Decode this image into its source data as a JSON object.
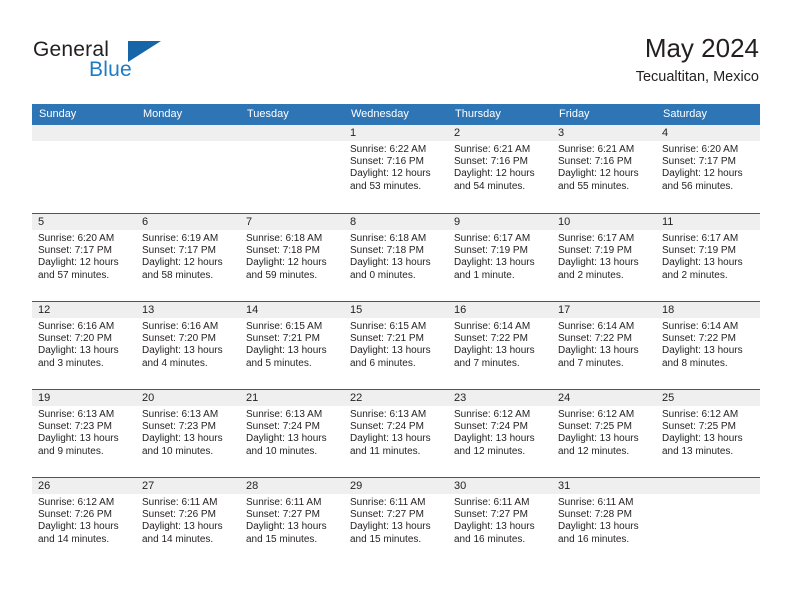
{
  "brand": {
    "name_part1": "General",
    "name_part2": "Blue",
    "triangle_icon": "blue-triangle-logo-mark",
    "accent_color": "#1d7cc4",
    "triangle_color": "#1565a8"
  },
  "header": {
    "title": "May 2024",
    "subtitle": "Tecualtitan, Mexico"
  },
  "theme": {
    "header_row_color": "#2e75b6",
    "row_divider_color": "#1f5fa0",
    "day_strip_color": "#efefef",
    "text_color": "#231f20"
  },
  "weekdays": [
    "Sunday",
    "Monday",
    "Tuesday",
    "Wednesday",
    "Thursday",
    "Friday",
    "Saturday"
  ],
  "weeks": [
    [
      {
        "day": "",
        "empty": true,
        "sunrise": "",
        "sunset": "",
        "daylight_line1": "",
        "daylight_line2": ""
      },
      {
        "day": "",
        "empty": true,
        "sunrise": "",
        "sunset": "",
        "daylight_line1": "",
        "daylight_line2": ""
      },
      {
        "day": "",
        "empty": true,
        "sunrise": "",
        "sunset": "",
        "daylight_line1": "",
        "daylight_line2": ""
      },
      {
        "day": "1",
        "sunrise": "Sunrise: 6:22 AM",
        "sunset": "Sunset: 7:16 PM",
        "daylight_line1": "Daylight: 12 hours",
        "daylight_line2": "and 53 minutes."
      },
      {
        "day": "2",
        "sunrise": "Sunrise: 6:21 AM",
        "sunset": "Sunset: 7:16 PM",
        "daylight_line1": "Daylight: 12 hours",
        "daylight_line2": "and 54 minutes."
      },
      {
        "day": "3",
        "sunrise": "Sunrise: 6:21 AM",
        "sunset": "Sunset: 7:16 PM",
        "daylight_line1": "Daylight: 12 hours",
        "daylight_line2": "and 55 minutes."
      },
      {
        "day": "4",
        "sunrise": "Sunrise: 6:20 AM",
        "sunset": "Sunset: 7:17 PM",
        "daylight_line1": "Daylight: 12 hours",
        "daylight_line2": "and 56 minutes."
      }
    ],
    [
      {
        "day": "5",
        "sunrise": "Sunrise: 6:20 AM",
        "sunset": "Sunset: 7:17 PM",
        "daylight_line1": "Daylight: 12 hours",
        "daylight_line2": "and 57 minutes."
      },
      {
        "day": "6",
        "sunrise": "Sunrise: 6:19 AM",
        "sunset": "Sunset: 7:17 PM",
        "daylight_line1": "Daylight: 12 hours",
        "daylight_line2": "and 58 minutes."
      },
      {
        "day": "7",
        "sunrise": "Sunrise: 6:18 AM",
        "sunset": "Sunset: 7:18 PM",
        "daylight_line1": "Daylight: 12 hours",
        "daylight_line2": "and 59 minutes."
      },
      {
        "day": "8",
        "sunrise": "Sunrise: 6:18 AM",
        "sunset": "Sunset: 7:18 PM",
        "daylight_line1": "Daylight: 13 hours",
        "daylight_line2": "and 0 minutes."
      },
      {
        "day": "9",
        "sunrise": "Sunrise: 6:17 AM",
        "sunset": "Sunset: 7:19 PM",
        "daylight_line1": "Daylight: 13 hours",
        "daylight_line2": "and 1 minute."
      },
      {
        "day": "10",
        "sunrise": "Sunrise: 6:17 AM",
        "sunset": "Sunset: 7:19 PM",
        "daylight_line1": "Daylight: 13 hours",
        "daylight_line2": "and 2 minutes."
      },
      {
        "day": "11",
        "sunrise": "Sunrise: 6:17 AM",
        "sunset": "Sunset: 7:19 PM",
        "daylight_line1": "Daylight: 13 hours",
        "daylight_line2": "and 2 minutes."
      }
    ],
    [
      {
        "day": "12",
        "sunrise": "Sunrise: 6:16 AM",
        "sunset": "Sunset: 7:20 PM",
        "daylight_line1": "Daylight: 13 hours",
        "daylight_line2": "and 3 minutes."
      },
      {
        "day": "13",
        "sunrise": "Sunrise: 6:16 AM",
        "sunset": "Sunset: 7:20 PM",
        "daylight_line1": "Daylight: 13 hours",
        "daylight_line2": "and 4 minutes."
      },
      {
        "day": "14",
        "sunrise": "Sunrise: 6:15 AM",
        "sunset": "Sunset: 7:21 PM",
        "daylight_line1": "Daylight: 13 hours",
        "daylight_line2": "and 5 minutes."
      },
      {
        "day": "15",
        "sunrise": "Sunrise: 6:15 AM",
        "sunset": "Sunset: 7:21 PM",
        "daylight_line1": "Daylight: 13 hours",
        "daylight_line2": "and 6 minutes."
      },
      {
        "day": "16",
        "sunrise": "Sunrise: 6:14 AM",
        "sunset": "Sunset: 7:22 PM",
        "daylight_line1": "Daylight: 13 hours",
        "daylight_line2": "and 7 minutes."
      },
      {
        "day": "17",
        "sunrise": "Sunrise: 6:14 AM",
        "sunset": "Sunset: 7:22 PM",
        "daylight_line1": "Daylight: 13 hours",
        "daylight_line2": "and 7 minutes."
      },
      {
        "day": "18",
        "sunrise": "Sunrise: 6:14 AM",
        "sunset": "Sunset: 7:22 PM",
        "daylight_line1": "Daylight: 13 hours",
        "daylight_line2": "and 8 minutes."
      }
    ],
    [
      {
        "day": "19",
        "sunrise": "Sunrise: 6:13 AM",
        "sunset": "Sunset: 7:23 PM",
        "daylight_line1": "Daylight: 13 hours",
        "daylight_line2": "and 9 minutes."
      },
      {
        "day": "20",
        "sunrise": "Sunrise: 6:13 AM",
        "sunset": "Sunset: 7:23 PM",
        "daylight_line1": "Daylight: 13 hours",
        "daylight_line2": "and 10 minutes."
      },
      {
        "day": "21",
        "sunrise": "Sunrise: 6:13 AM",
        "sunset": "Sunset: 7:24 PM",
        "daylight_line1": "Daylight: 13 hours",
        "daylight_line2": "and 10 minutes."
      },
      {
        "day": "22",
        "sunrise": "Sunrise: 6:13 AM",
        "sunset": "Sunset: 7:24 PM",
        "daylight_line1": "Daylight: 13 hours",
        "daylight_line2": "and 11 minutes."
      },
      {
        "day": "23",
        "sunrise": "Sunrise: 6:12 AM",
        "sunset": "Sunset: 7:24 PM",
        "daylight_line1": "Daylight: 13 hours",
        "daylight_line2": "and 12 minutes."
      },
      {
        "day": "24",
        "sunrise": "Sunrise: 6:12 AM",
        "sunset": "Sunset: 7:25 PM",
        "daylight_line1": "Daylight: 13 hours",
        "daylight_line2": "and 12 minutes."
      },
      {
        "day": "25",
        "sunrise": "Sunrise: 6:12 AM",
        "sunset": "Sunset: 7:25 PM",
        "daylight_line1": "Daylight: 13 hours",
        "daylight_line2": "and 13 minutes."
      }
    ],
    [
      {
        "day": "26",
        "sunrise": "Sunrise: 6:12 AM",
        "sunset": "Sunset: 7:26 PM",
        "daylight_line1": "Daylight: 13 hours",
        "daylight_line2": "and 14 minutes."
      },
      {
        "day": "27",
        "sunrise": "Sunrise: 6:11 AM",
        "sunset": "Sunset: 7:26 PM",
        "daylight_line1": "Daylight: 13 hours",
        "daylight_line2": "and 14 minutes."
      },
      {
        "day": "28",
        "sunrise": "Sunrise: 6:11 AM",
        "sunset": "Sunset: 7:27 PM",
        "daylight_line1": "Daylight: 13 hours",
        "daylight_line2": "and 15 minutes."
      },
      {
        "day": "29",
        "sunrise": "Sunrise: 6:11 AM",
        "sunset": "Sunset: 7:27 PM",
        "daylight_line1": "Daylight: 13 hours",
        "daylight_line2": "and 15 minutes."
      },
      {
        "day": "30",
        "sunrise": "Sunrise: 6:11 AM",
        "sunset": "Sunset: 7:27 PM",
        "daylight_line1": "Daylight: 13 hours",
        "daylight_line2": "and 16 minutes."
      },
      {
        "day": "31",
        "sunrise": "Sunrise: 6:11 AM",
        "sunset": "Sunset: 7:28 PM",
        "daylight_line1": "Daylight: 13 hours",
        "daylight_line2": "and 16 minutes."
      },
      {
        "day": "",
        "empty": true,
        "sunrise": "",
        "sunset": "",
        "daylight_line1": "",
        "daylight_line2": ""
      }
    ]
  ]
}
